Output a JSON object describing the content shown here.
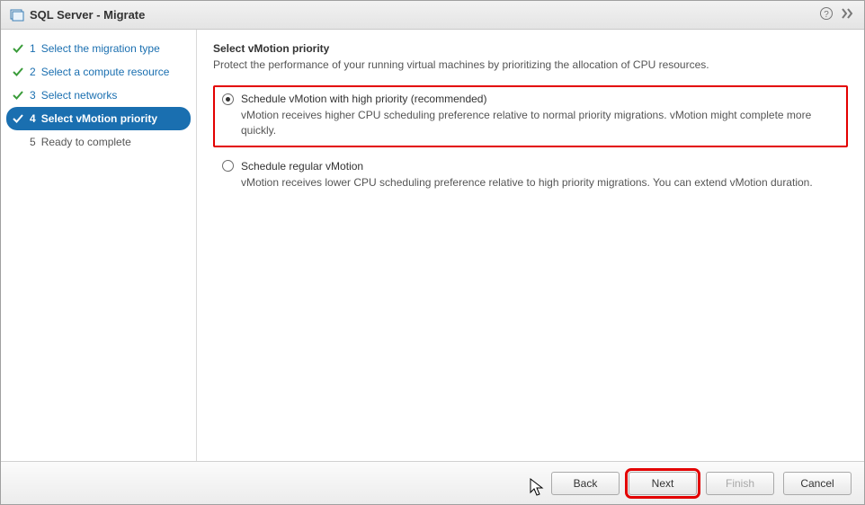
{
  "window": {
    "title": "SQL Server - Migrate"
  },
  "sidebar": {
    "steps": [
      {
        "num": "1",
        "label": "Select the migration type"
      },
      {
        "num": "2",
        "label": "Select a compute resource"
      },
      {
        "num": "3",
        "label": "Select networks"
      },
      {
        "num": "4",
        "label": "Select vMotion priority"
      },
      {
        "num": "5",
        "label": "Ready to complete"
      }
    ]
  },
  "content": {
    "heading": "Select vMotion priority",
    "subtitle": "Protect the performance of your running virtual machines by prioritizing the allocation of CPU resources.",
    "options": [
      {
        "label": "Schedule vMotion with high priority (recommended)",
        "desc": "vMotion receives higher CPU scheduling preference relative to normal priority migrations. vMotion might complete more quickly."
      },
      {
        "label": "Schedule regular vMotion",
        "desc": "vMotion receives lower CPU scheduling preference relative to high priority migrations. You can extend vMotion duration."
      }
    ]
  },
  "footer": {
    "back": "Back",
    "next": "Next",
    "finish": "Finish",
    "cancel": "Cancel"
  }
}
